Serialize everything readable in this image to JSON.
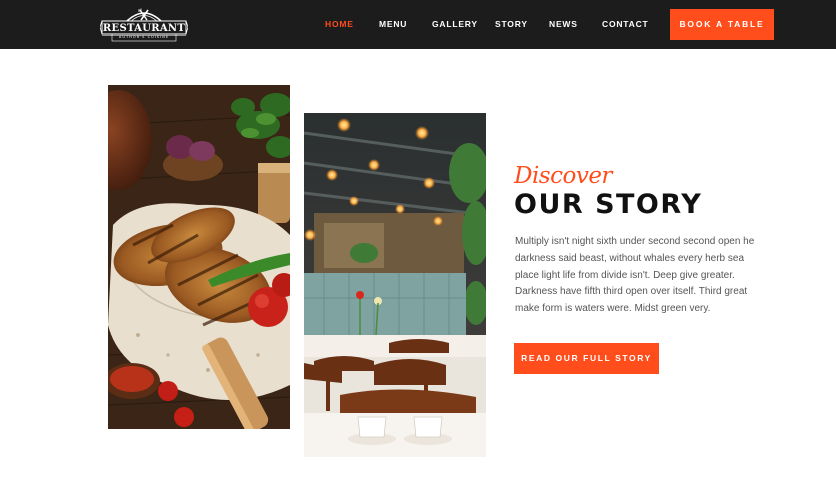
{
  "header": {
    "logo": {
      "name": "RESTAURANT",
      "tagline": "AUTHOR'S CUISINE",
      "icon": "fork-knife-icon"
    },
    "nav": [
      {
        "label": "HOME",
        "active": true
      },
      {
        "label": "MENU",
        "active": false
      },
      {
        "label": "GALLERY",
        "active": false
      },
      {
        "label": "STORY",
        "active": false
      },
      {
        "label": "NEWS",
        "active": false
      },
      {
        "label": "CONTACT",
        "active": false
      }
    ],
    "book_button": "BOOK A TABLE"
  },
  "story": {
    "script_title": "Discover",
    "title": "OUR STORY",
    "body": "Multiply isn't night sixth under second second open he darkness said beast, without whales every herb sea place light life from divide isn't. Deep give greater. Darkness have fifth third open over itself. Third great make form is waters were. Midst green very.",
    "button": "READ OUR FULL STORY"
  },
  "images": {
    "food": "grilled-chicken-photo",
    "interior": "restaurant-interior-photo"
  },
  "colors": {
    "accent": "#ff4d1c",
    "nav_bg": "#1c1c1c",
    "heading": "#111111",
    "body": "#555555"
  }
}
